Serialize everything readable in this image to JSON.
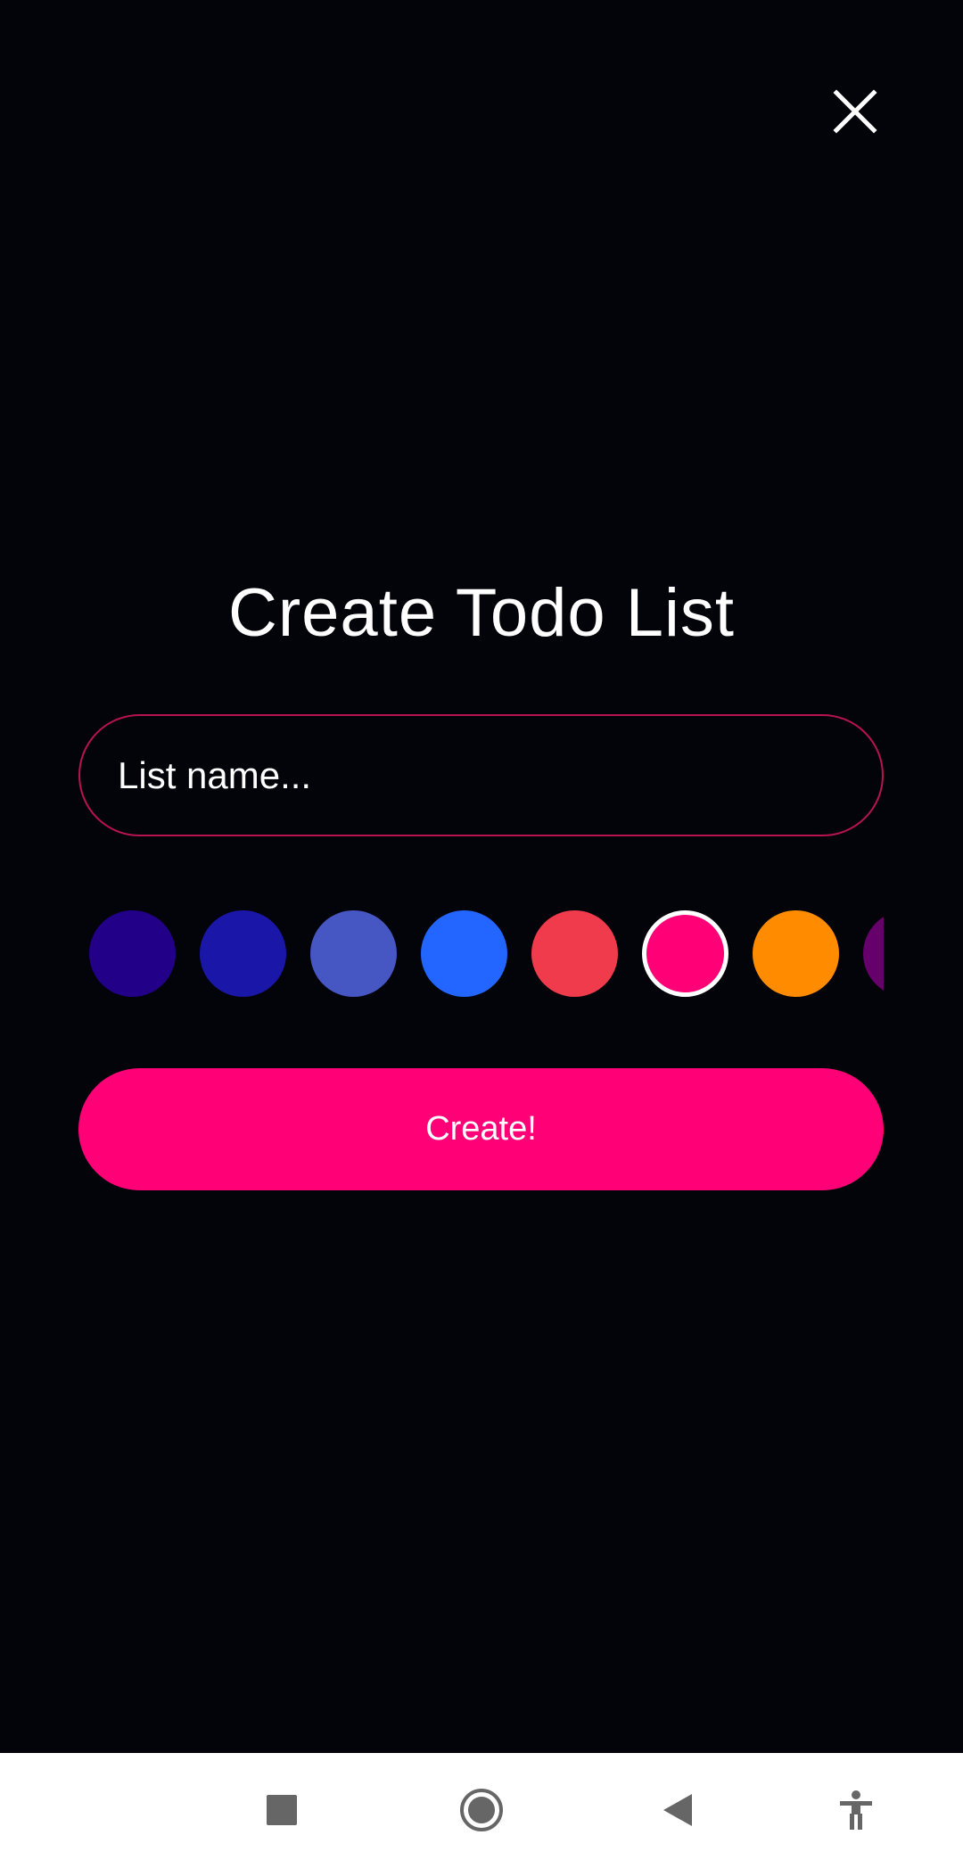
{
  "screen": {
    "title": "Create Todo List",
    "close_icon": "close-icon"
  },
  "form": {
    "name_placeholder": "List name...",
    "name_value": "",
    "create_label": "Create!",
    "create_color": "#ff0077",
    "input_border_color": "#b8144f"
  },
  "swatches": [
    {
      "color": "#220088",
      "selected": false
    },
    {
      "color": "#1a17a8",
      "selected": false
    },
    {
      "color": "#4656c2",
      "selected": false
    },
    {
      "color": "#2266ff",
      "selected": false
    },
    {
      "color": "#ef3b4b",
      "selected": false
    },
    {
      "color": "#ff0077",
      "selected": true
    },
    {
      "color": "#ff8c00",
      "selected": false
    },
    {
      "color": "#66006a",
      "selected": false
    }
  ],
  "navbar": {
    "icons": [
      "recents-square-icon",
      "home-circle-icon",
      "back-triangle-icon",
      "accessibility-icon"
    ],
    "icon_color": "#666666"
  },
  "colors": {
    "background": "#03030a",
    "text": "#ffffff"
  }
}
